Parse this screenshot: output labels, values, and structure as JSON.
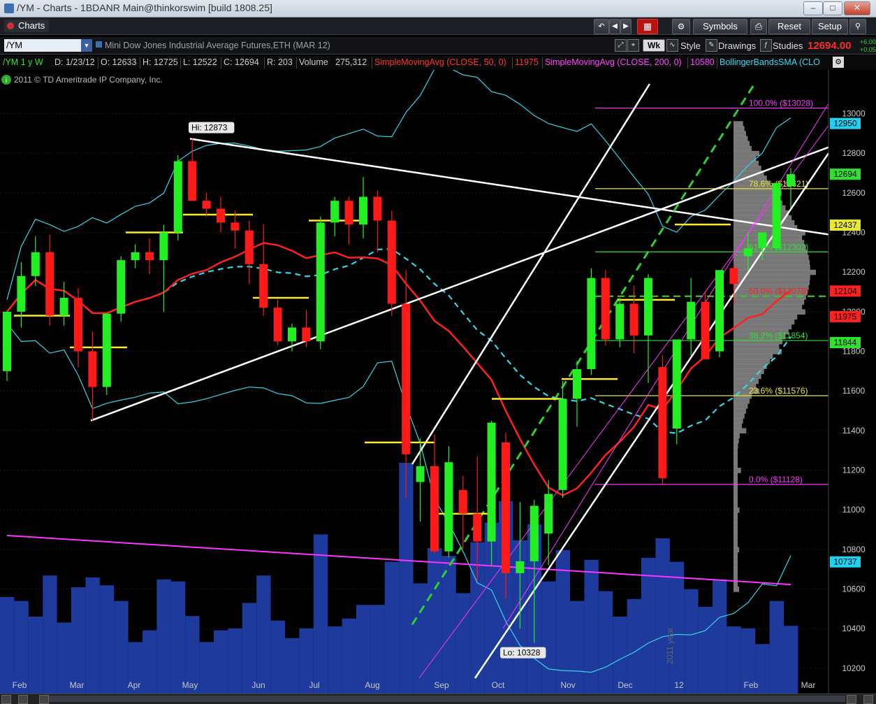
{
  "window": {
    "title": "/YM - Charts - 1BDANR Main@thinkorswim [build 1808.25]",
    "minimize": "–",
    "maximize": "□",
    "close": "✕"
  },
  "toolbar": {
    "tab_label": "Charts",
    "symbols_label": "Symbols",
    "reset_label": "Reset",
    "setup_label": "Setup"
  },
  "symbol_bar": {
    "symbol": "/YM",
    "description": "Mini Dow Jones Industrial Average Futures,ETH (MAR 12)",
    "period": "Wk",
    "style_label": "Style",
    "drawings_label": "Drawings",
    "studies_label": "Studies",
    "last": "12694.00",
    "change": "+6.00",
    "change_pct": "+0.05"
  },
  "status": {
    "chart_id": "/YM 1 y W",
    "date": "D: 1/23/12",
    "open": "O: 12633",
    "high": "H: 12725",
    "low": "L: 12522",
    "close": "C: 12694",
    "range": "R: 203",
    "volume_label": "Volume",
    "volume": "275,312",
    "sma50_label": "SimpleMovingAvg (CLOSE, 50, 0)",
    "sma50": "11975",
    "sma200_label": "SimpleMovingAvg (CLOSE, 200, 0)",
    "sma200": "10580",
    "bb_label": "BollingerBandsSMA (CLO"
  },
  "copyright": "2011 © TD Ameritrade IP Company, Inc.",
  "chart_data": {
    "type": "candlestick",
    "ylim": [
      10150,
      13150
    ],
    "y_ticks": [
      10200,
      10400,
      10600,
      10800,
      11000,
      11200,
      11400,
      11600,
      11800,
      12000,
      12200,
      12400,
      12600,
      12800,
      13000
    ],
    "x_labels": [
      "Feb",
      "Mar",
      "Apr",
      "May",
      "Jun",
      "Jul",
      "Aug",
      "Sep",
      "Oct",
      "Nov",
      "Dec",
      "12",
      "Feb",
      "Mar"
    ],
    "year_label": "2011 year",
    "hi_label": "Hi: 12873",
    "lo_label": "Lo: 10328",
    "candles": [
      [
        11700,
        12000,
        11650,
        12000
      ],
      [
        12000,
        12250,
        11920,
        12180
      ],
      [
        12180,
        12380,
        12130,
        12300
      ],
      [
        12300,
        12390,
        11930,
        11980
      ],
      [
        11980,
        12150,
        11930,
        12070
      ],
      [
        12070,
        12120,
        11720,
        11800
      ],
      [
        11800,
        11900,
        11450,
        11620
      ],
      [
        11620,
        11990,
        11580,
        11990
      ],
      [
        11990,
        12280,
        11950,
        12260
      ],
      [
        12260,
        12340,
        12220,
        12300
      ],
      [
        12300,
        12370,
        12190,
        12260
      ],
      [
        12260,
        12440,
        12000,
        12400
      ],
      [
        12400,
        12790,
        12360,
        12760
      ],
      [
        12760,
        12873,
        12620,
        12560
      ],
      [
        12560,
        12600,
        12480,
        12520
      ],
      [
        12520,
        12580,
        12400,
        12450
      ],
      [
        12450,
        12510,
        12320,
        12410
      ],
      [
        12410,
        12460,
        12140,
        12240
      ],
      [
        12240,
        12440,
        11980,
        12020
      ],
      [
        12020,
        12060,
        11830,
        11850
      ],
      [
        11850,
        11940,
        11800,
        11920
      ],
      [
        11920,
        12010,
        11820,
        11850
      ],
      [
        11850,
        12480,
        11810,
        12450
      ],
      [
        12450,
        12580,
        12380,
        12560
      ],
      [
        12560,
        12580,
        12340,
        12440
      ],
      [
        12440,
        12680,
        12370,
        12580
      ],
      [
        12580,
        12610,
        12300,
        12460
      ],
      [
        12460,
        12510,
        11980,
        12040
      ],
      [
        12040,
        12210,
        11060,
        11280
      ],
      [
        11140,
        11360,
        10940,
        11220
      ],
      [
        11220,
        11380,
        10780,
        10790
      ],
      [
        10790,
        11320,
        10760,
        11240
      ],
      [
        11100,
        11170,
        10800,
        10980
      ],
      [
        10980,
        11270,
        10640,
        10840
      ],
      [
        10840,
        11450,
        10720,
        11440
      ],
      [
        11340,
        11390,
        10550,
        10680
      ],
      [
        10680,
        11040,
        10400,
        10740
      ],
      [
        10740,
        11050,
        10328,
        11020
      ],
      [
        10880,
        11150,
        10720,
        11080
      ],
      [
        11100,
        11650,
        11060,
        11560
      ],
      [
        11560,
        11750,
        11420,
        11710
      ],
      [
        11710,
        12220,
        11680,
        12170
      ],
      [
        12170,
        12210,
        11830,
        11860
      ],
      [
        11860,
        12070,
        11820,
        12040
      ],
      [
        12040,
        12130,
        11790,
        11880
      ],
      [
        11880,
        12190,
        11640,
        12170
      ],
      [
        11720,
        11780,
        11130,
        11160
      ],
      [
        11410,
        11860,
        11330,
        11860
      ],
      [
        11860,
        12170,
        11780,
        12050
      ],
      [
        12050,
        12100,
        11800,
        11760
      ],
      [
        11800,
        12210,
        11770,
        12210
      ],
      [
        12220,
        12240,
        12040,
        12140
      ],
      [
        12280,
        12400,
        12210,
        12320
      ],
      [
        12320,
        12370,
        12260,
        12400
      ],
      [
        12320,
        12640,
        12310,
        12650
      ],
      [
        12633,
        12725,
        12522,
        12694
      ]
    ],
    "annotations": {
      "fib": [
        {
          "label": "100.0% ($13028)",
          "value": 13028,
          "color": "#ff33ff"
        },
        {
          "label": "78.6% ($12621)",
          "value": 12621,
          "color": "#e8e830"
        },
        {
          "label": "61.8% ($12302)",
          "value": 12302,
          "color": "#30e030"
        },
        {
          "label": "50.0% ($12078)",
          "value": 12078,
          "color": "#ff2020"
        },
        {
          "label": "38.2% ($11854)",
          "value": 11854,
          "color": "#30e030"
        },
        {
          "label": "23.6% ($11576)",
          "value": 11576,
          "color": "#e8e830"
        },
        {
          "label": "0.0% ($11128)",
          "value": 11128,
          "color": "#ff33ff"
        }
      ]
    },
    "price_labels": [
      {
        "text": "12950",
        "value": 12950,
        "color": "#20d0f0"
      },
      {
        "text": "12694",
        "value": 12694,
        "color": "#30e030"
      },
      {
        "text": "12437",
        "value": 12437,
        "color": "#e8e830"
      },
      {
        "text": "12104",
        "value": 12104,
        "color": "#ff2020"
      },
      {
        "text": "11975",
        "value": 11975,
        "color": "#ff2020"
      },
      {
        "text": "11844",
        "value": 11844,
        "color": "#30e030"
      },
      {
        "text": "10737",
        "value": 10737,
        "color": "#20d0f0"
      }
    ],
    "colors": {
      "up": "#22f022",
      "down": "#ff1a1a",
      "sma50": "#ff2020",
      "sma200": "#ff33ff",
      "bb": "#33d6e6",
      "volume": "#1d3a9c",
      "axis_text": "#c8c8c8"
    }
  }
}
